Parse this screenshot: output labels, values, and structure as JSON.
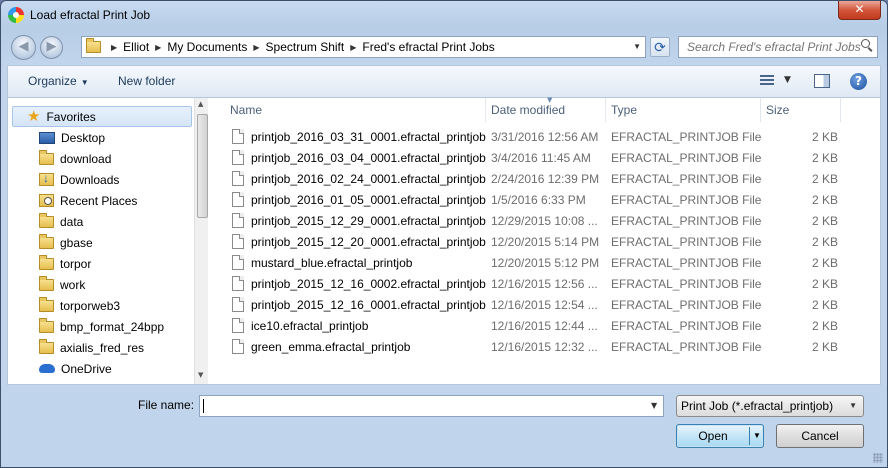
{
  "window": {
    "title": "Load efractal Print Job",
    "close_label": "✕"
  },
  "address": {
    "crumbs": [
      "Elliot",
      "My Documents",
      "Spectrum Shift",
      "Fred's efractal Print Jobs"
    ],
    "search_placeholder": "Search Fred's efractal Print Jobs"
  },
  "toolbar": {
    "organize_label": "Organize",
    "new_folder_label": "New folder",
    "help_label": "?"
  },
  "sidebar": {
    "favorites_label": "Favorites",
    "items": [
      {
        "label": "Desktop",
        "icon": "desktop-icon"
      },
      {
        "label": "download",
        "icon": "folder-icon"
      },
      {
        "label": "Downloads",
        "icon": "downloads-icon"
      },
      {
        "label": "Recent Places",
        "icon": "recent-places-icon"
      },
      {
        "label": "data",
        "icon": "folder-icon"
      },
      {
        "label": "gbase",
        "icon": "folder-icon"
      },
      {
        "label": "torpor",
        "icon": "folder-icon"
      },
      {
        "label": "work",
        "icon": "folder-icon"
      },
      {
        "label": "torporweb3",
        "icon": "folder-icon"
      },
      {
        "label": "bmp_format_24bpp",
        "icon": "folder-icon"
      },
      {
        "label": "axialis_fred_res",
        "icon": "folder-icon"
      },
      {
        "label": "OneDrive",
        "icon": "onedrive-icon"
      }
    ]
  },
  "file_list": {
    "columns": [
      "Name",
      "Date modified",
      "Type",
      "Size"
    ],
    "rows": [
      {
        "name": "printjob_2016_03_31_0001.efractal_printjob",
        "date": "3/31/2016 12:56 AM",
        "type": "EFRACTAL_PRINTJOB File",
        "size": "2 KB"
      },
      {
        "name": "printjob_2016_03_04_0001.efractal_printjob",
        "date": "3/4/2016 11:45 AM",
        "type": "EFRACTAL_PRINTJOB File",
        "size": "2 KB"
      },
      {
        "name": "printjob_2016_02_24_0001.efractal_printjob",
        "date": "2/24/2016 12:39 PM",
        "type": "EFRACTAL_PRINTJOB File",
        "size": "2 KB"
      },
      {
        "name": "printjob_2016_01_05_0001.efractal_printjob",
        "date": "1/5/2016 6:33 PM",
        "type": "EFRACTAL_PRINTJOB File",
        "size": "2 KB"
      },
      {
        "name": "printjob_2015_12_29_0001.efractal_printjob",
        "date": "12/29/2015 10:08 ...",
        "type": "EFRACTAL_PRINTJOB File",
        "size": "2 KB"
      },
      {
        "name": "printjob_2015_12_20_0001.efractal_printjob",
        "date": "12/20/2015 5:14 PM",
        "type": "EFRACTAL_PRINTJOB File",
        "size": "2 KB"
      },
      {
        "name": "mustard_blue.efractal_printjob",
        "date": "12/20/2015 5:12 PM",
        "type": "EFRACTAL_PRINTJOB File",
        "size": "2 KB"
      },
      {
        "name": "printjob_2015_12_16_0002.efractal_printjob",
        "date": "12/16/2015 12:56 ...",
        "type": "EFRACTAL_PRINTJOB File",
        "size": "2 KB"
      },
      {
        "name": "printjob_2015_12_16_0001.efractal_printjob",
        "date": "12/16/2015 12:54 ...",
        "type": "EFRACTAL_PRINTJOB File",
        "size": "2 KB"
      },
      {
        "name": "ice10.efractal_printjob",
        "date": "12/16/2015 12:44 ...",
        "type": "EFRACTAL_PRINTJOB File",
        "size": "2 KB"
      },
      {
        "name": "green_emma.efractal_printjob",
        "date": "12/16/2015 12:32 ...",
        "type": "EFRACTAL_PRINTJOB File",
        "size": "2 KB"
      }
    ]
  },
  "footer": {
    "file_name_label": "File name:",
    "file_name_value": "",
    "filter_label": "Print Job (*.efractal_printjob)",
    "open_label": "Open",
    "cancel_label": "Cancel"
  }
}
